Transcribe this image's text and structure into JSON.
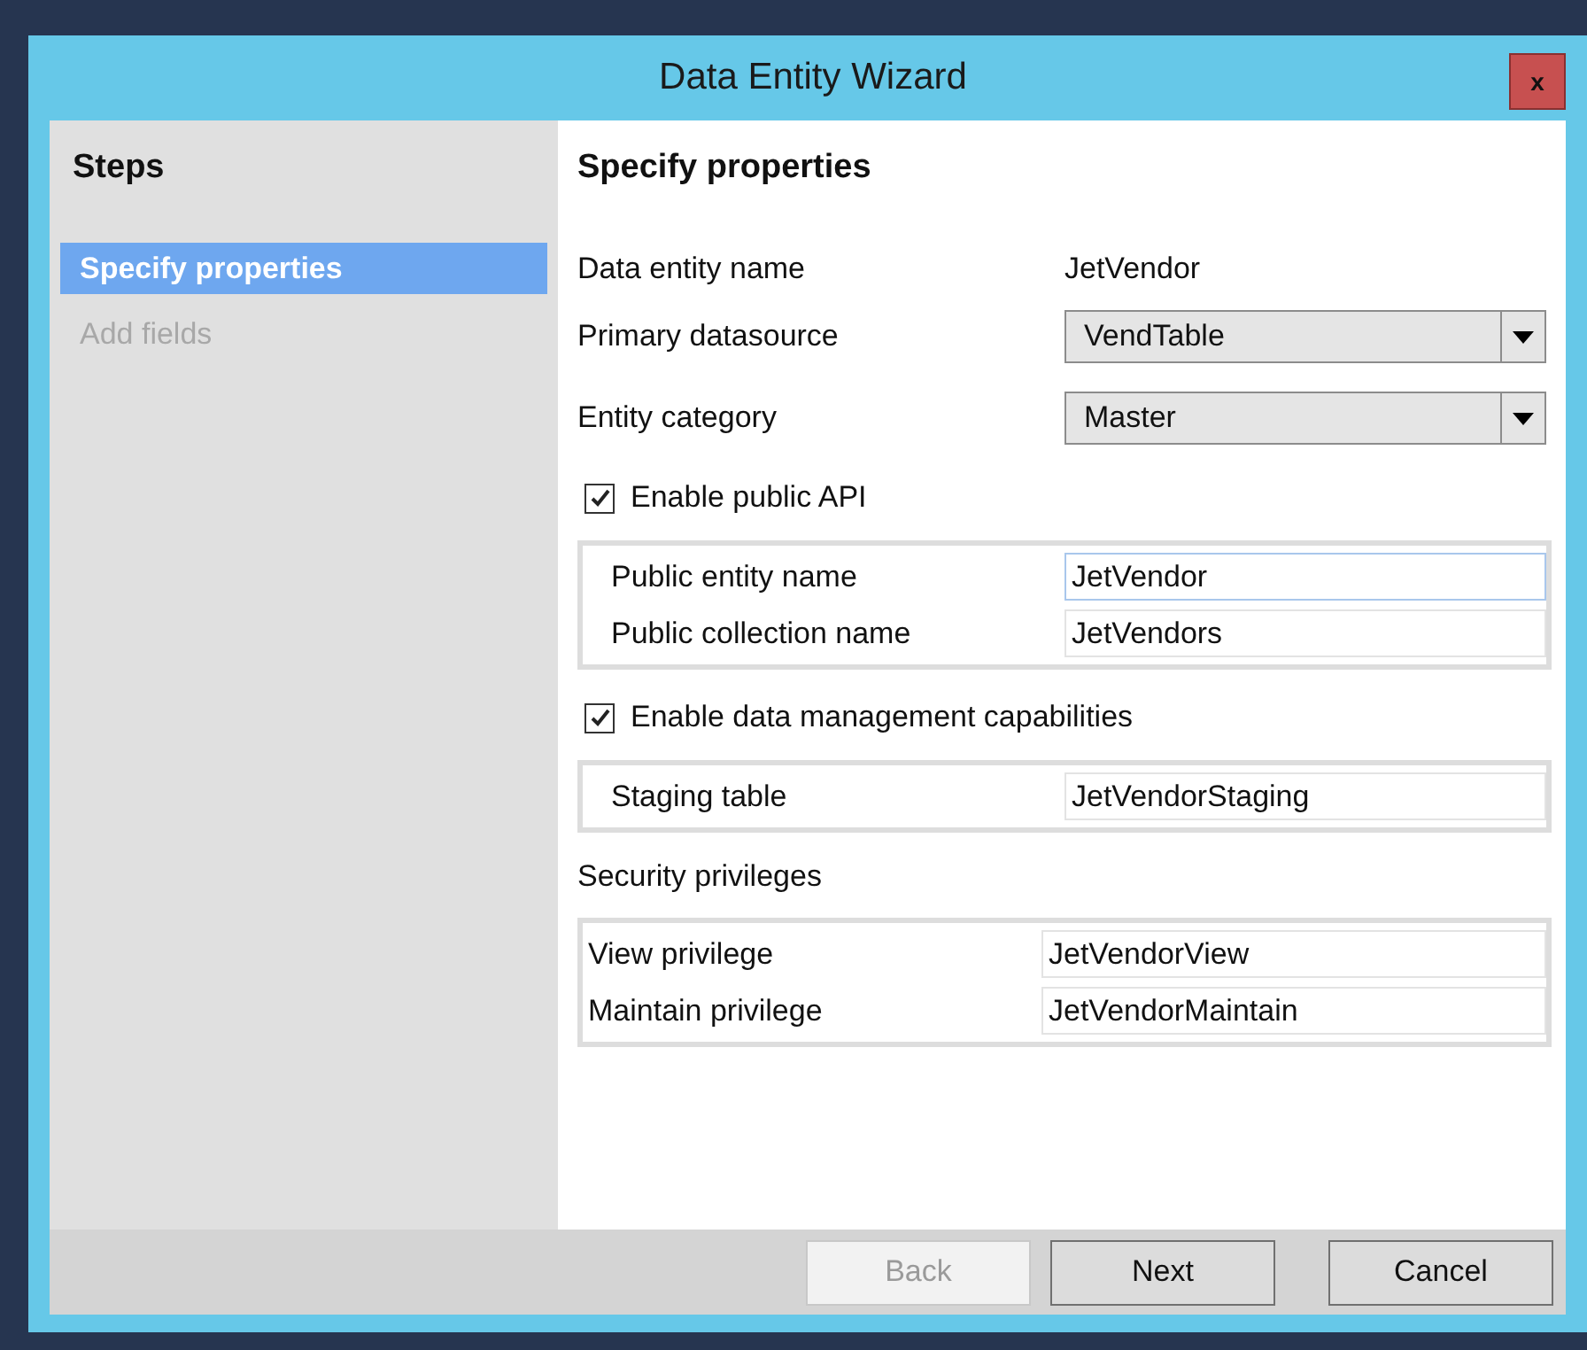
{
  "window": {
    "title": "Data Entity Wizard",
    "close_label": "x"
  },
  "steps": {
    "heading": "Steps",
    "items": [
      {
        "label": "Specify properties",
        "selected": true,
        "disabled": false
      },
      {
        "label": "Add fields",
        "selected": false,
        "disabled": true
      }
    ]
  },
  "form": {
    "heading": "Specify properties",
    "rows": [
      {
        "kind": "static",
        "label": "Data entity name",
        "value": "JetVendor"
      },
      {
        "kind": "dropdown",
        "label": "Primary datasource",
        "value": "VendTable"
      },
      {
        "kind": "dropdown",
        "label": "Entity category",
        "value": "Master"
      },
      {
        "kind": "checkbox",
        "label": "Enable public API",
        "checked": true
      },
      {
        "kind": "group",
        "fields": [
          {
            "label": "Public entity name",
            "value": "JetVendor",
            "focused": true
          },
          {
            "label": "Public collection name",
            "value": "JetVendors",
            "focused": false
          }
        ]
      },
      {
        "kind": "checkbox",
        "label": "Enable data management capabilities",
        "checked": true
      },
      {
        "kind": "group",
        "fields": [
          {
            "label": "Staging table",
            "value": "JetVendorStaging",
            "focused": false
          }
        ]
      },
      {
        "kind": "label",
        "label": "Security privileges"
      },
      {
        "kind": "flush-group",
        "fields": [
          {
            "label": "View privilege",
            "value": "JetVendorView",
            "focused": false
          },
          {
            "label": "Maintain privilege",
            "value": "JetVendorMaintain",
            "focused": false
          }
        ]
      }
    ]
  },
  "buttons": [
    {
      "label": "Back",
      "disabled": true
    },
    {
      "label": "Next",
      "disabled": false
    },
    {
      "label": "Cancel",
      "disabled": false
    }
  ]
}
